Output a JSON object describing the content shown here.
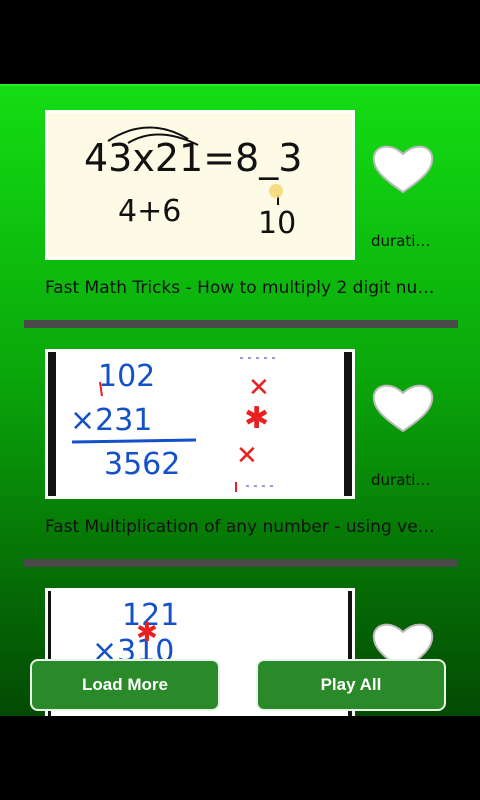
{
  "videos": [
    {
      "title": "Fast Math Tricks - How to multiply 2 digit nu…",
      "duration": "durati…"
    },
    {
      "title": "Fast Multiplication of any number - using ve…",
      "duration": "durati…"
    },
    {
      "title": "",
      "duration": ""
    }
  ],
  "buttons": {
    "load_more": "Load More",
    "play_all": "Play All"
  },
  "thumbnails": {
    "t1": {
      "line1": "43x21=8_3",
      "line2": "4+6",
      "line3": "10"
    },
    "t2": {
      "n1": "102",
      "n2": "×231",
      "n3": "3562"
    },
    "t3": {
      "n1": "121",
      "n2": "×310"
    }
  },
  "colors": {
    "accent_green": "#0aa80a",
    "button_green": "#2a8a2a",
    "ink_blue": "#1450c8",
    "mark_red": "#e82020"
  },
  "icons": {
    "favorite": "heart-icon"
  }
}
